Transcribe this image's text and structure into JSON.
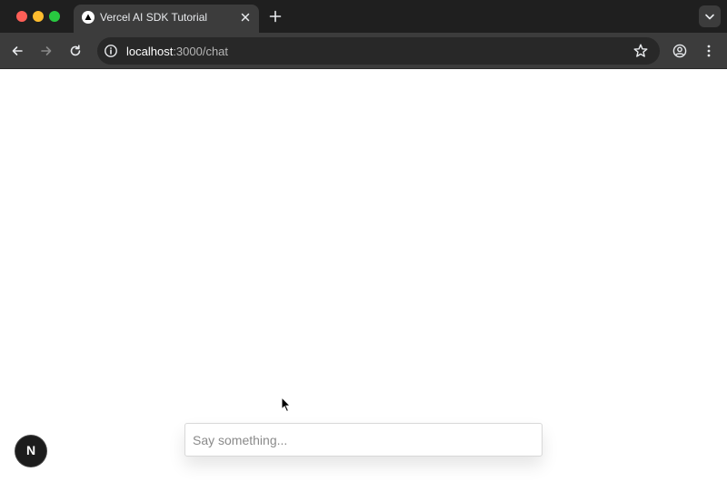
{
  "browser": {
    "tab": {
      "title": "Vercel AI SDK Tutorial",
      "favicon": "vercel-triangle-icon"
    },
    "address_bar": {
      "host": "localhost",
      "path": ":3000/chat"
    }
  },
  "page": {
    "chat_input": {
      "value": "",
      "placeholder": "Say something..."
    },
    "dev_badge": {
      "label": "N",
      "icon": "nextjs-logo-icon"
    }
  },
  "colors": {
    "chrome_dark": "#1f1f1f",
    "toolbar": "#3c3c3c",
    "omnibox": "#282828"
  }
}
